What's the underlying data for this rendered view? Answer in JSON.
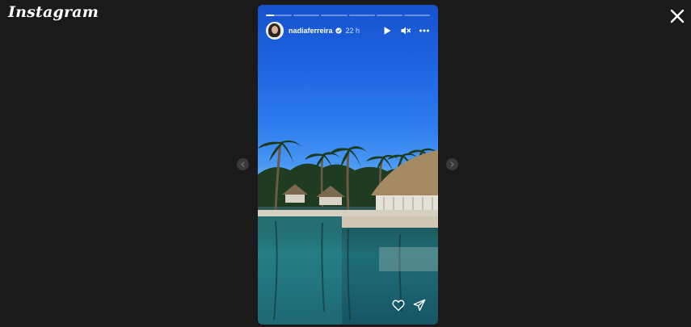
{
  "app": {
    "logo_text": "Instagram"
  },
  "story": {
    "progress": {
      "segment_count": 6,
      "current_index": 0,
      "current_fraction": 0.3
    },
    "user": {
      "username": "nadiaferreira",
      "verified": true
    },
    "posted_ago": "22 h"
  },
  "icons": {
    "close": "close-icon",
    "prev": "chevron-left-icon",
    "next": "chevron-right-icon",
    "play": "play-icon",
    "mute": "speaker-muted-icon",
    "more": "more-options-icon",
    "like": "heart-icon",
    "share": "send-icon",
    "verified": "verified-badge-icon"
  },
  "colors": {
    "background": "#1a1a1a",
    "verified_badge": "#ffffff"
  }
}
